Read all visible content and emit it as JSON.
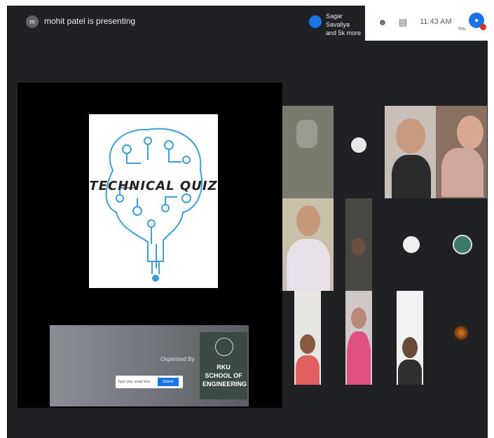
{
  "top_bar": {
    "presenter_chip": "m",
    "presenting_text": "mohit patel is presenting",
    "joined_text_line1": "Sagar Savaliya",
    "joined_text_line2": "and 5k more",
    "time": "11:43 AM",
    "you_label": "You",
    "you_initial": "●"
  },
  "slide": {
    "title": "TECHNICAL QUIZ"
  },
  "banner": {
    "organised_by": "Organised By",
    "register_placeholder": "Type your email here",
    "register_button": "Submit",
    "school_name": "RKU SCHOOL OF ENGINEERING"
  },
  "icons": {
    "participants": "people-icon",
    "chat": "chat-icon",
    "presenter_chip": "avatar-icon",
    "brain": "brain-circuit-icon"
  },
  "colors": {
    "meet_dark": "#202124",
    "accent_blue": "#1a73e8",
    "alert_red": "#d93025",
    "circuit_blue": "#3aa0d8"
  }
}
